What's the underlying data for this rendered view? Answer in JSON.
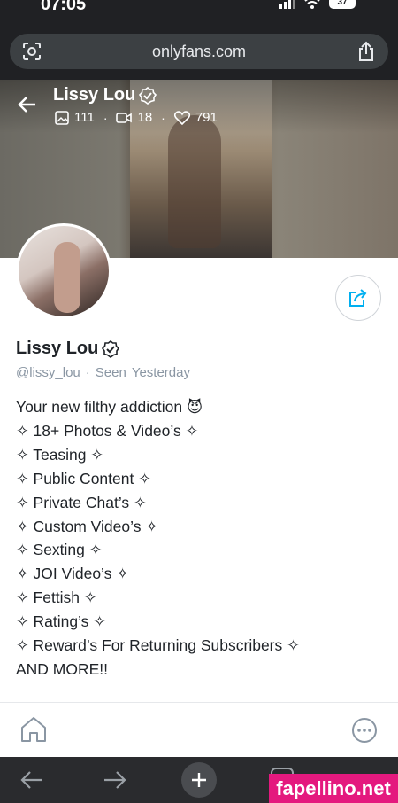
{
  "status_bar": {
    "time": "07:05",
    "battery": "37"
  },
  "browser": {
    "url": "onlyfans.com"
  },
  "cover": {
    "name": "Lissy Lou",
    "photos_count": "111",
    "videos_count": "18",
    "likes_count": "791"
  },
  "profile": {
    "name": "Lissy Lou",
    "handle": "@lissy_lou",
    "separator": "·",
    "seen_label": "Seen",
    "seen_value": "Yesterday",
    "bio": [
      "Your new filthy addiction 😈",
      "✧ 18+ Photos & Video’s ✧",
      "✧ Teasing ✧",
      "✧ Public Content ✧",
      "✧ Private Chat’s ✧",
      "✧ Custom Video’s ✧",
      "✧ Sexting ✧",
      "✧ JOI Video’s ✧",
      "✧ Fettish ✧",
      "✧ Rating’s ✧",
      "✧ Reward’s For Returning Subscribers ✧",
      "AND MORE!!"
    ]
  },
  "watermark": "fapellino.net",
  "colors": {
    "brand_blue": "#00aff0",
    "muted": "#8a96a3",
    "watermark_pink": "#e4197e"
  }
}
